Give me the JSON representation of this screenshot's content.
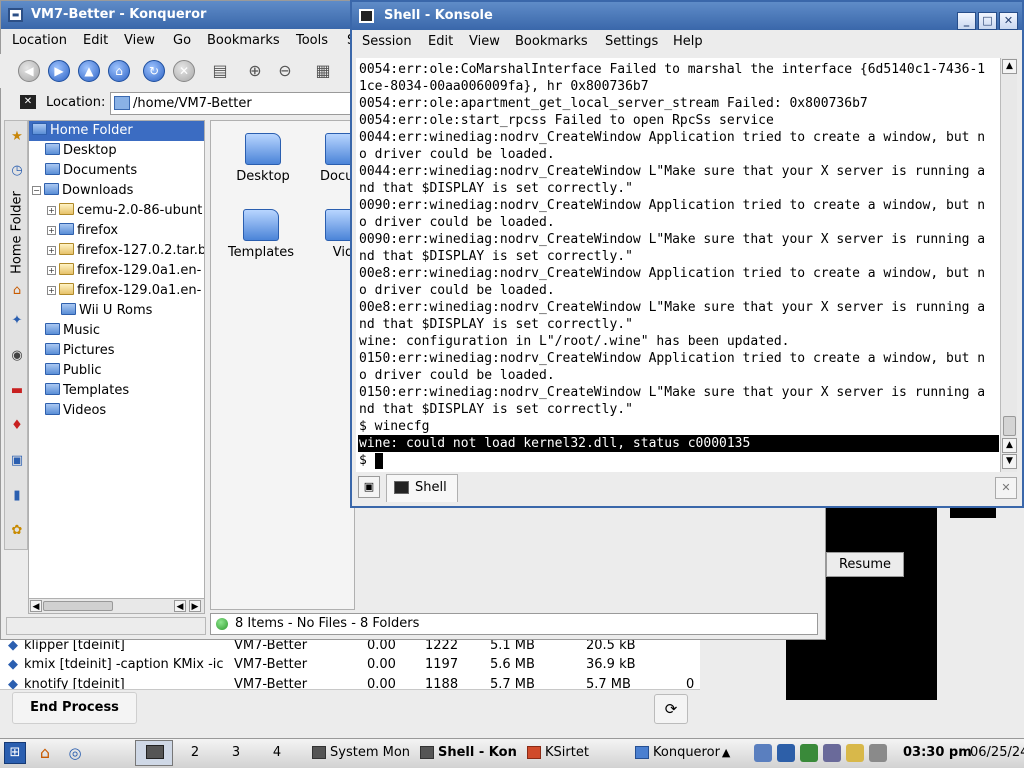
{
  "konqueror": {
    "title": "VM7-Better - Konqueror",
    "menu": [
      "Location",
      "Edit",
      "View",
      "Go",
      "Bookmarks",
      "Tools",
      "S"
    ],
    "location_label": "Location:",
    "location_value": "/home/VM7-Better",
    "sidebar_tab_label": "Home Folder",
    "tree": [
      {
        "label": "Home Folder",
        "selected": true
      },
      {
        "label": "Desktop"
      },
      {
        "label": "Documents"
      },
      {
        "label": "Downloads"
      },
      {
        "label": "cemu-2.0-86-ubunt"
      },
      {
        "label": "firefox"
      },
      {
        "label": "firefox-127.0.2.tar.b"
      },
      {
        "label": "firefox-129.0a1.en-"
      },
      {
        "label": "firefox-129.0a1.en-"
      },
      {
        "label": "Wii U Roms"
      },
      {
        "label": "Music"
      },
      {
        "label": "Pictures"
      },
      {
        "label": "Public"
      },
      {
        "label": "Templates"
      },
      {
        "label": "Videos"
      }
    ],
    "icons": [
      {
        "label": "Desktop"
      },
      {
        "label": "Docum"
      },
      {
        "label": "Templates"
      },
      {
        "label": "Vid"
      }
    ],
    "status": "8 Items - No Files - 8 Folders"
  },
  "konsole": {
    "title": "Shell - Konsole",
    "menu": [
      "Session",
      "Edit",
      "View",
      "Bookmarks",
      "Settings",
      "Help"
    ],
    "lines": [
      "0054:err:ole:CoMarshalInterface Failed to marshal the interface {6d5140c1-7436-1",
      "1ce-8034-00aa006009fa}, hr 0x800736b7",
      "0054:err:ole:apartment_get_local_server_stream Failed: 0x800736b7",
      "0054:err:ole:start_rpcss Failed to open RpcSs service",
      "0044:err:winediag:nodrv_CreateWindow Application tried to create a window, but n",
      "o driver could be loaded.",
      "0044:err:winediag:nodrv_CreateWindow L\"Make sure that your X server is running a",
      "nd that $DISPLAY is set correctly.\"",
      "0090:err:winediag:nodrv_CreateWindow Application tried to create a window, but n",
      "o driver could be loaded.",
      "0090:err:winediag:nodrv_CreateWindow L\"Make sure that your X server is running a",
      "nd that $DISPLAY is set correctly.\"",
      "00e8:err:winediag:nodrv_CreateWindow Application tried to create a window, but n",
      "o driver could be loaded.",
      "00e8:err:winediag:nodrv_CreateWindow L\"Make sure that your X server is running a",
      "nd that $DISPLAY is set correctly.\"",
      "wine: configuration in L\"/root/.wine\" has been updated.",
      "0150:err:winediag:nodrv_CreateWindow Application tried to create a window, but n",
      "o driver could be loaded.",
      "0150:err:winediag:nodrv_CreateWindow L\"Make sure that your X server is running a",
      "nd that $DISPLAY is set correctly.\"",
      "$ winecfg",
      "wine: could not load kernel32.dll, status c0000135",
      "$ "
    ],
    "tab_label": "Shell"
  },
  "sysmon": {
    "rows": [
      {
        "name": "klipper [tdeinit]",
        "user": "VM7-Better",
        "cpu": "0.00",
        "pid": "1222",
        "mem": "5.1 MB",
        "shared": "20.5 kB"
      },
      {
        "name": "kmix [tdeinit] -caption KMix -ic",
        "user": "VM7-Better",
        "cpu": "0.00",
        "pid": "1197",
        "mem": "5.6 MB",
        "shared": "36.9 kB"
      },
      {
        "name": "knotify [tdeinit]",
        "user": "VM7-Better",
        "cpu": "0.00",
        "pid": "1188",
        "mem": "5.7 MB",
        "shared": "5.7 MB",
        "extra": "0"
      }
    ],
    "end_process": "End Process"
  },
  "ksirtet": {
    "resume": "Resume"
  },
  "taskbar": {
    "desktops": [
      "2",
      "3",
      "4"
    ],
    "tasks": [
      "System Mon",
      "Shell - Kon",
      "KSirtet",
      "Konqueror"
    ],
    "time": "03:30 pm",
    "date": "06/25/24"
  }
}
